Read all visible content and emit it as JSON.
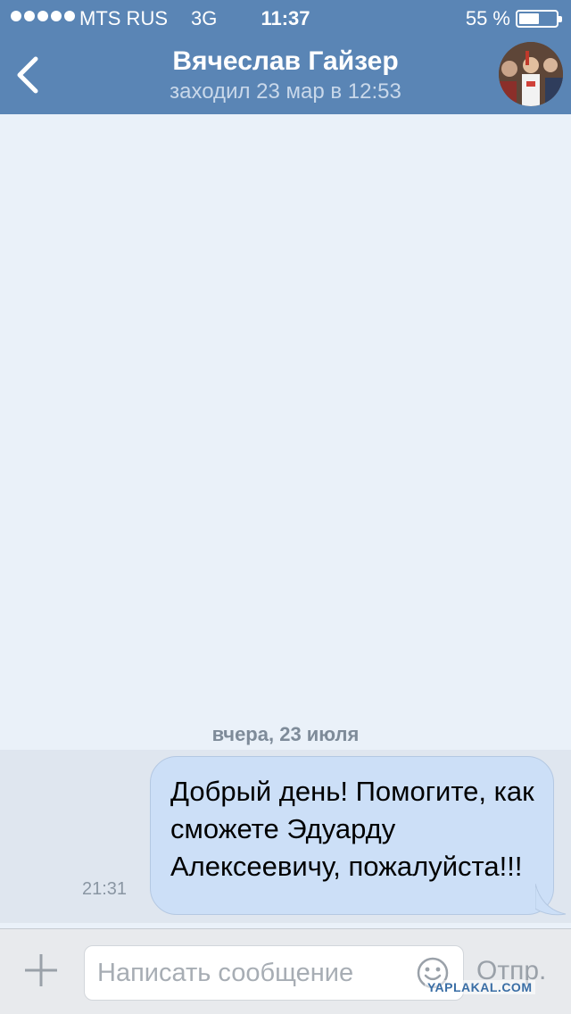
{
  "status_bar": {
    "carrier": "MTS RUS",
    "network": "3G",
    "time": "11:37",
    "battery_percent": "55 %",
    "battery_level": 0.55
  },
  "nav": {
    "back_icon": "chevron-left-icon",
    "contact_name": "Вячеслав Гайзер",
    "last_seen": "заходил 23 мар в 12:53"
  },
  "chat": {
    "date_divider": "вчера, 23 июля",
    "messages": [
      {
        "text": "Добрый день! Помогите, как сможете Эдуарду Алексеевичу, пожалуйста!!!",
        "time": "21:31",
        "direction": "outgoing"
      }
    ]
  },
  "input_bar": {
    "attach_icon": "plus-icon",
    "placeholder": "Написать сообщение",
    "emoji_icon": "smiley-icon",
    "send_label": "Отпр."
  },
  "watermark": "YAPLAKAL.COM",
  "colors": {
    "header": "#5a85b5",
    "chat_background": "#eaf1f9",
    "outgoing_bubble": "#ccdff7"
  }
}
